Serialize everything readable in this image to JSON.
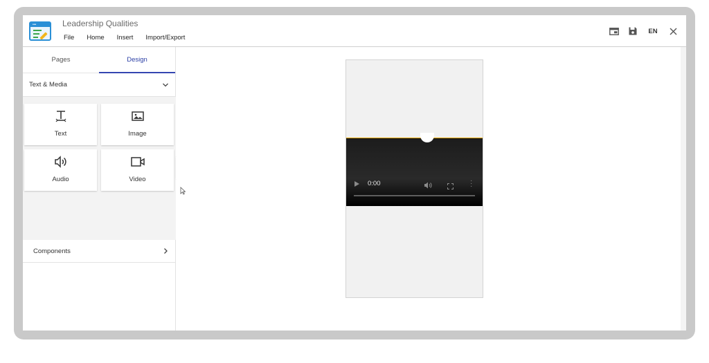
{
  "header": {
    "doc_title": "Leadership Qualities",
    "menu": [
      "File",
      "Home",
      "Insert",
      "Import/Export"
    ],
    "lang": "EN"
  },
  "panel": {
    "tabs": [
      {
        "label": "Pages",
        "active": false
      },
      {
        "label": "Design",
        "active": true
      }
    ],
    "section_text_media": "Text & Media",
    "tiles": [
      {
        "label": "Text",
        "icon": "text-icon"
      },
      {
        "label": "Image",
        "icon": "image-icon"
      },
      {
        "label": "Audio",
        "icon": "audio-icon"
      },
      {
        "label": "Video",
        "icon": "video-icon"
      }
    ],
    "section_components": "Components"
  },
  "video_player": {
    "time": "0:00"
  },
  "colors": {
    "accent": "#3446b1",
    "video_border": "#e2a400",
    "logo_blue": "#2a8fd6"
  }
}
